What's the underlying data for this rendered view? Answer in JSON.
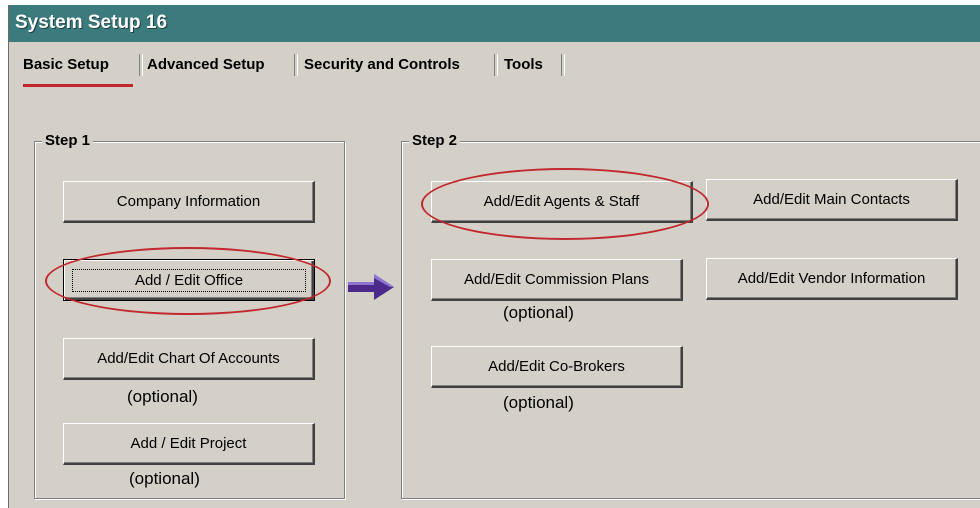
{
  "window": {
    "title": "System Setup 16"
  },
  "tabs": [
    {
      "label": "Basic Setup",
      "active": true
    },
    {
      "label": "Advanced Setup"
    },
    {
      "label": "Security and Controls"
    },
    {
      "label": "Tools"
    }
  ],
  "step1": {
    "label": "Step 1",
    "buttons": {
      "company": "Company Information",
      "office": "Add / Edit Office",
      "chart": "Add/Edit Chart Of Accounts",
      "project": "Add / Edit Project"
    },
    "chart_note": "(optional)",
    "project_note": "(optional)"
  },
  "step2": {
    "label": "Step 2",
    "buttons": {
      "agents": "Add/Edit Agents & Staff",
      "main_contacts": "Add/Edit Main Contacts",
      "commission": "Add/Edit Commission Plans",
      "vendor": "Add/Edit Vendor Information",
      "cobrokers": "Add/Edit Co-Brokers"
    },
    "commission_note": "(optional)",
    "cobrokers_note": "(optional)"
  },
  "colors": {
    "titlebar": "#3b7b7d",
    "face": "#d4d0c8",
    "highlight_oval": "#c1272d",
    "arrow": "#4b2a8c"
  },
  "icons": {
    "arrow": "right-arrow-icon"
  }
}
